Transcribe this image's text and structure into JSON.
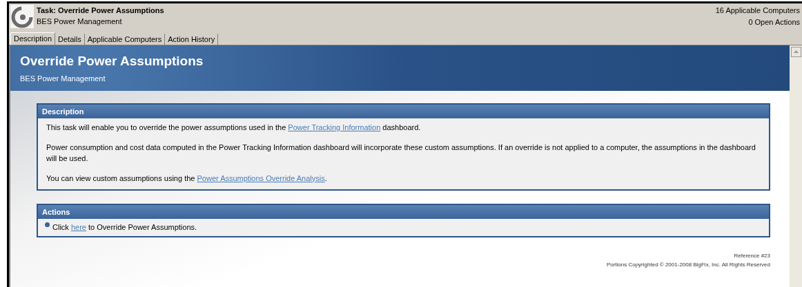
{
  "header": {
    "title": "Task: Override Power Assumptions",
    "subtitle": "BES Power Management",
    "counts": [
      "16 Applicable Computers",
      "0 Open Actions"
    ]
  },
  "tabs": [
    {
      "label": "Description",
      "selected": true
    },
    {
      "label": "Details",
      "selected": false
    },
    {
      "label": "Applicable Computers",
      "selected": false
    },
    {
      "label": "Action History",
      "selected": false
    }
  ],
  "banner": {
    "title": "Override Power Assumptions",
    "subtitle": "BES Power Management"
  },
  "description": {
    "title": "Description",
    "paragraphs": [
      [
        {
          "text": "This task will enable you to override the power assumptions used in the "
        },
        {
          "text": "Power Tracking Information",
          "link": true
        },
        {
          "text": " dashboard."
        }
      ],
      [
        {
          "text": "Power consumption and cost data computed in the Power Tracking Information dashboard will incorporate these custom assumptions.  If an override is not applied to a computer, the assumptions in the dashboard will be used."
        }
      ],
      [
        {
          "text": "You can view custom assumptions using the "
        },
        {
          "text": "Power Assumptions Override Analysis",
          "link": true
        },
        {
          "text": "."
        }
      ]
    ]
  },
  "actions": {
    "title": "Actions",
    "items": [
      [
        {
          "text": "Click "
        },
        {
          "text": "here",
          "link": true
        },
        {
          "text": " to Override Power Assumptions."
        }
      ]
    ]
  },
  "footer": {
    "reference": "Reference #23",
    "copyright": "Portions Copyrighted © 2001-2008 BigFix, Inc. All Rights Reserved"
  }
}
